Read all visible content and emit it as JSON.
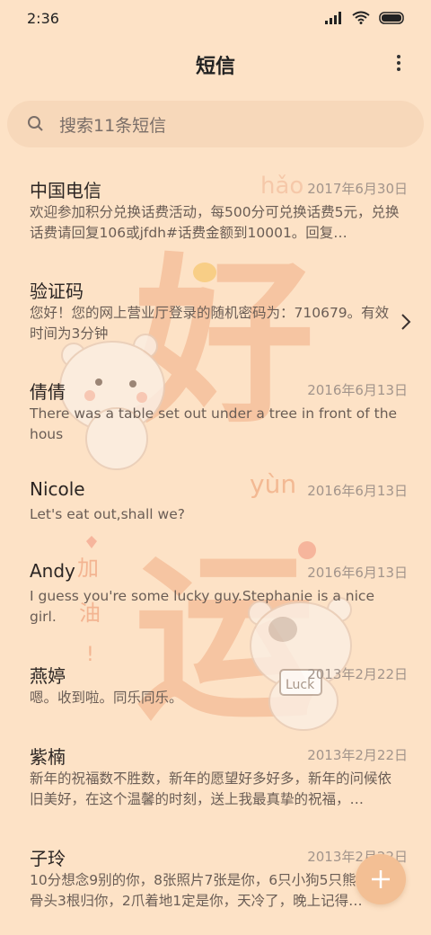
{
  "status_bar": {
    "time": "2:36"
  },
  "header": {
    "title": "短信"
  },
  "search": {
    "placeholder": "搜索11条短信"
  },
  "messages": [
    {
      "sender": "中国电信",
      "date": "2017年6月30日",
      "preview": "欢迎参加积分兑换话费活动，每500分可兑换话费5元，兑换话费请回复106或jfdh#话费金额到10001。回复…"
    },
    {
      "sender": "验证码",
      "date": "",
      "preview": "您好！您的网上营业厅登录的随机密码为：710679。有效时间为3分钟"
    },
    {
      "sender": "倩倩",
      "date": "2016年6月13日",
      "preview": "There was a table set out under a tree in front of the hous"
    },
    {
      "sender": "Nicole",
      "date": "2016年6月13日",
      "preview": "Let's eat out,shall we?"
    },
    {
      "sender": "Andy",
      "date": "2016年6月13日",
      "preview": "I guess you're some lucky guy.Stephanie is a nice girl."
    },
    {
      "sender": "燕婷",
      "date": "2013年2月22日",
      "preview": "嗯。收到啦。同乐同乐。"
    },
    {
      "sender": "紫楠",
      "date": "2013年2月22日",
      "preview": "新年的祝福数不胜数，新年的愿望好多好多，新年的问候依旧美好，在这个温馨的时刻，送上我最真挚的祝福，…"
    },
    {
      "sender": "子玲",
      "date": "2013年2月22日",
      "preview": "10分想念9别的你，8张照片7张是你，6只小狗5只熊，4根骨头3根归你，2爪着地1定是你，天冷了，晚上记得…"
    }
  ],
  "wallpaper": {
    "big_text": [
      "好",
      "运"
    ],
    "pinyin": [
      "hǎo",
      "yùn"
    ],
    "side_text": [
      "加",
      "油",
      "!"
    ],
    "sign": "Luck",
    "accent": "#f4b48a"
  },
  "colors": {
    "background": "#fde2c6",
    "search_bg": "#f7d8ba",
    "fab": "#f3bf94"
  }
}
